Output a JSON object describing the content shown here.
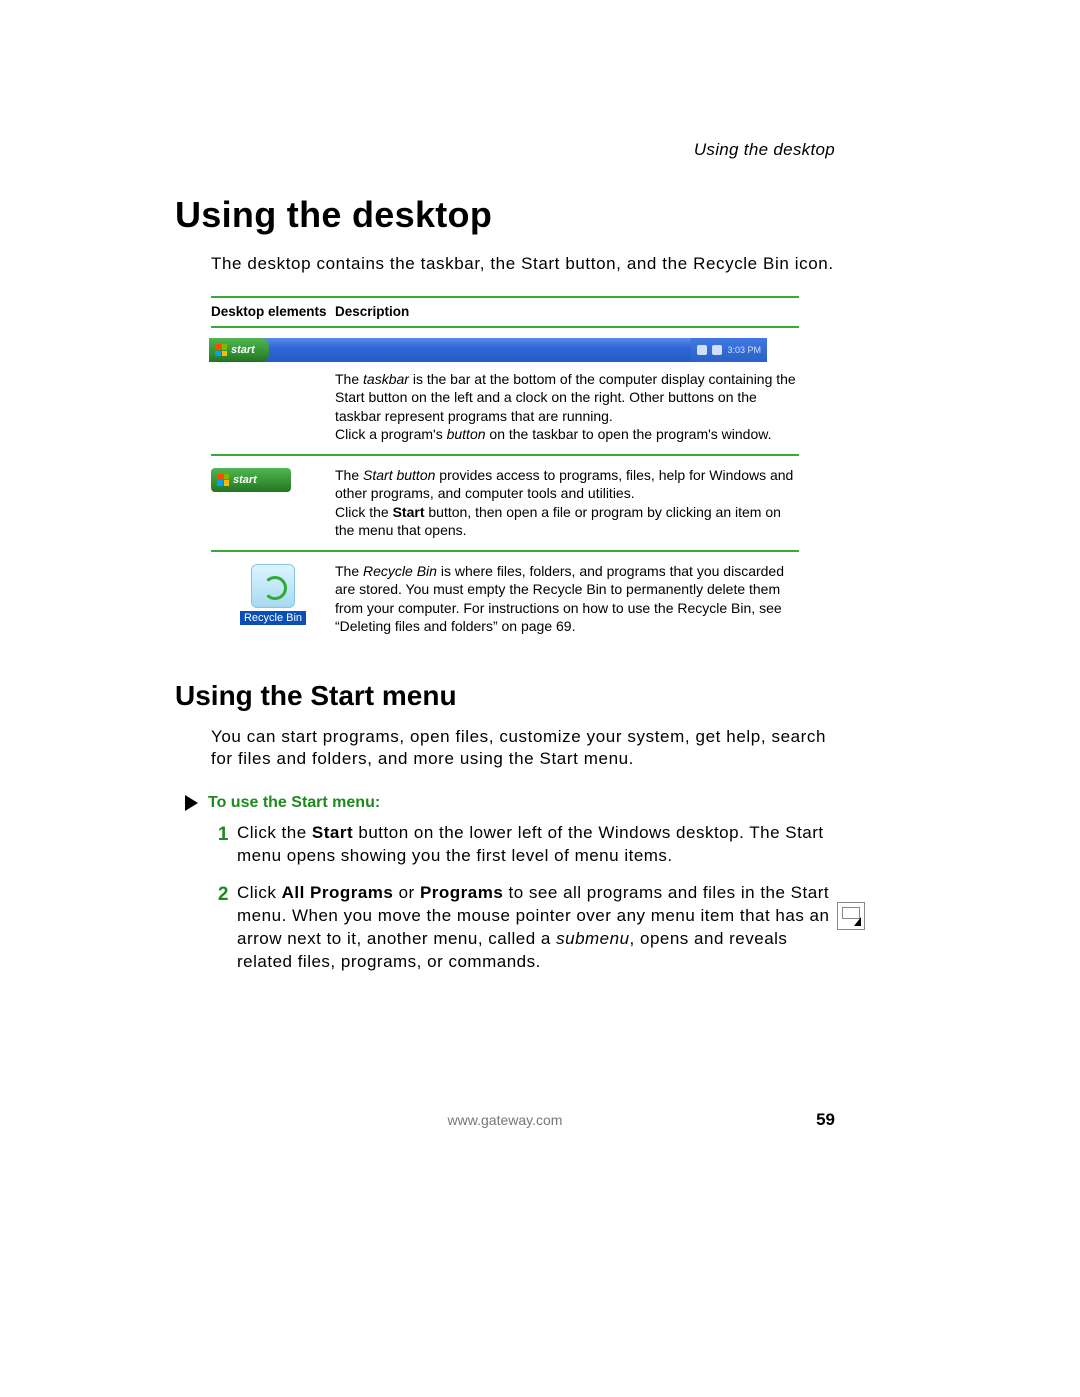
{
  "running_head": "Using the desktop",
  "h1": "Using the desktop",
  "intro": "The desktop contains the taskbar, the Start button, and the Recycle Bin icon.",
  "table": {
    "head": {
      "col1": "Desktop elements",
      "col2": "Description"
    },
    "rows": [
      {
        "element_label": "start",
        "tray_time": "3:03 PM",
        "desc_html": "The <em>taskbar</em> is the bar at the bottom of the computer display containing the Start button on the left and a clock on the right. Other buttons on the taskbar represent programs that are running.<br>Click a program's <em>button</em> on the taskbar to open the program's window."
      },
      {
        "element_label": "start",
        "desc_html": "The <em>Start button</em> provides access to programs, files, help for Windows and other programs, and computer tools and utilities.<br>Click the <b>Start</b> button, then open a file or program by clicking an item on the menu that opens."
      },
      {
        "element_label": "Recycle Bin",
        "desc_html": "The <em>Recycle Bin</em> is where files, folders, and programs that you discarded are stored. You must empty the Recycle Bin to permanently delete them from your computer. For instructions on how to use the Recycle Bin, see “Deleting files and folders” on page 69."
      }
    ]
  },
  "h2": "Using the Start menu",
  "p2": "You can start programs, open files, customize your system, get help, search for files and folders, and more using the Start menu.",
  "task_title": "To use the Start menu:",
  "steps": [
    {
      "n": "1",
      "html": "Click the <b>Start</b> button on the lower left of the Windows desktop. The Start menu opens showing you the first level of menu items."
    },
    {
      "n": "2",
      "html": "Click <b>All Programs</b> or <b>Programs</b> to see all programs and files in the Start menu. When you move the mouse pointer over any menu item that has an arrow next to it, another menu, called a <em>submenu</em>, opens and reveals related files, programs, or commands."
    }
  ],
  "footer": {
    "url": "www.gateway.com",
    "page": "59"
  }
}
